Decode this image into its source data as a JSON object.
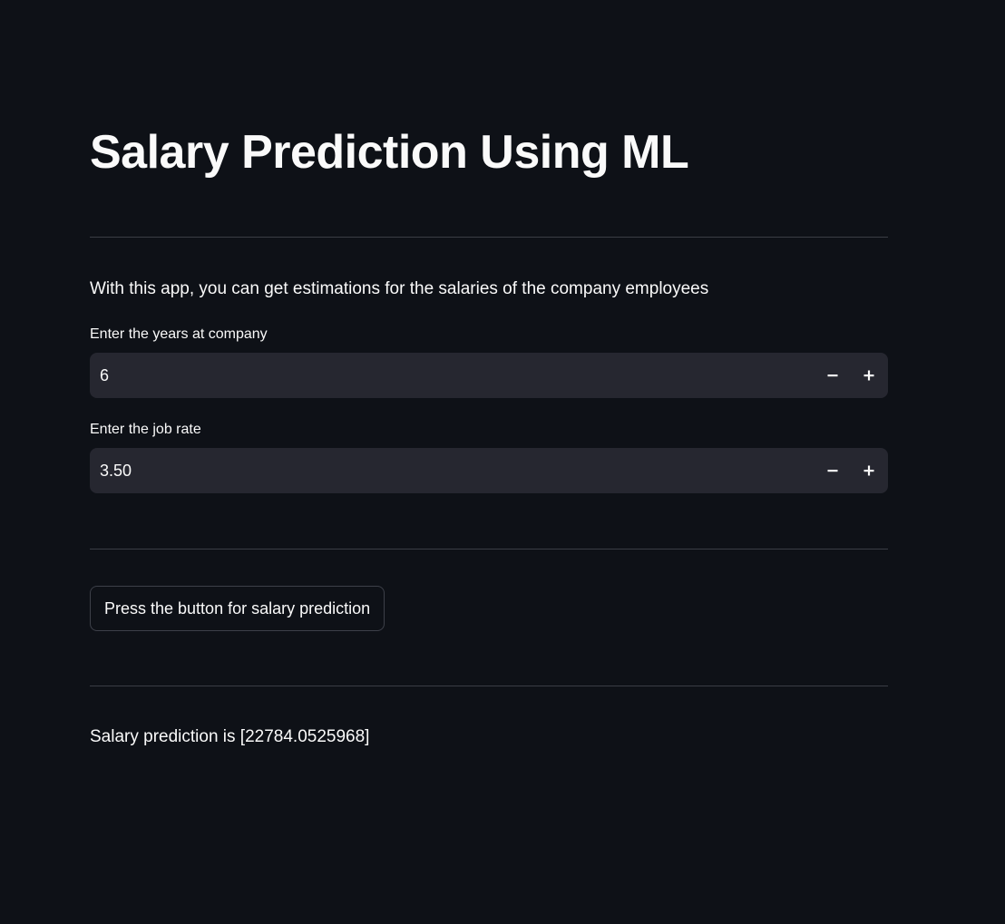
{
  "header": {
    "title": "Salary Prediction Using ML"
  },
  "description": "With this app, you can get estimations for the salaries of the company employees",
  "inputs": {
    "years": {
      "label": "Enter the years at company",
      "value": "6"
    },
    "job_rate": {
      "label": "Enter the job rate",
      "value": "3.50"
    }
  },
  "predict_button": {
    "label": "Press the button for salary prediction"
  },
  "result": {
    "text": "Salary prediction is [22784.0525968]"
  },
  "icons": {
    "decrement": "minus-icon",
    "increment": "plus-icon"
  },
  "colors": {
    "background": "#0e1117",
    "input_background": "#262730",
    "text": "#fafafa",
    "divider": "#3a3d45"
  }
}
